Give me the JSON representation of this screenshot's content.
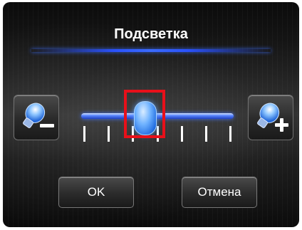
{
  "dialog": {
    "title": "Подсветка",
    "ok_label": "OK",
    "cancel_label": "Отмена"
  },
  "slider": {
    "level": 0.4,
    "tick_count": 7,
    "decrease_icon": "bulb-minus-icon",
    "increase_icon": "bulb-plus-icon"
  },
  "colors": {
    "accent": "#2a52ff",
    "highlight": "#e8101a"
  }
}
